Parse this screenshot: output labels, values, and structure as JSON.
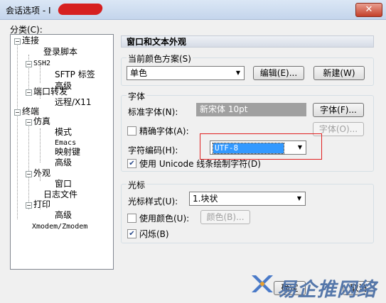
{
  "window": {
    "title": "会话选项 - I"
  },
  "categories_label": "分类(C):",
  "tree": {
    "connection": "连接",
    "login_script": "登录脚本",
    "ssh2": "SSH2",
    "sftp_tab": "SFTP 标签",
    "advanced1": "高级",
    "port_forward": "端口转发",
    "remote_x11": "远程/X11",
    "terminal": "终端",
    "emulation": "仿真",
    "modes": "模式",
    "emacs": "Emacs",
    "mapped_keys": "映射键",
    "advanced2": "高级",
    "appearance": "外观",
    "window": "窗口",
    "log_file": "日志文件",
    "printing": "打印",
    "advanced3": "高级",
    "xyz_modem": "Xmodem/Zmodem"
  },
  "panel": {
    "header": "窗口和文本外观",
    "scheme_group": "当前颜色方案(S)",
    "scheme_value": "单色",
    "edit_btn": "编辑(E)...",
    "new_btn": "新建(W)",
    "font_group": "字体",
    "std_font_label": "标准字体(N):",
    "std_font_value": "新宋体 10pt",
    "font_btn": "字体(F)...",
    "precise_font_label": "精确字体(A):",
    "precise_font_btn": "字体(O)...",
    "encoding_label": "字符编码(H):",
    "encoding_value": "UTF-8",
    "unicode_draw_label": "使用 Unicode 线条绘制字符(D)",
    "cursor_group": "光标",
    "cursor_style_label": "光标样式(U):",
    "cursor_style_value": "1.块状",
    "use_color_label": "使用颜色(U):",
    "color_btn": "颜色(B)...",
    "blink_label": "闪烁(B)"
  },
  "buttons": {
    "ok": "确定",
    "cancel": "取消"
  },
  "watermark": {
    "text": "易企推网络"
  }
}
